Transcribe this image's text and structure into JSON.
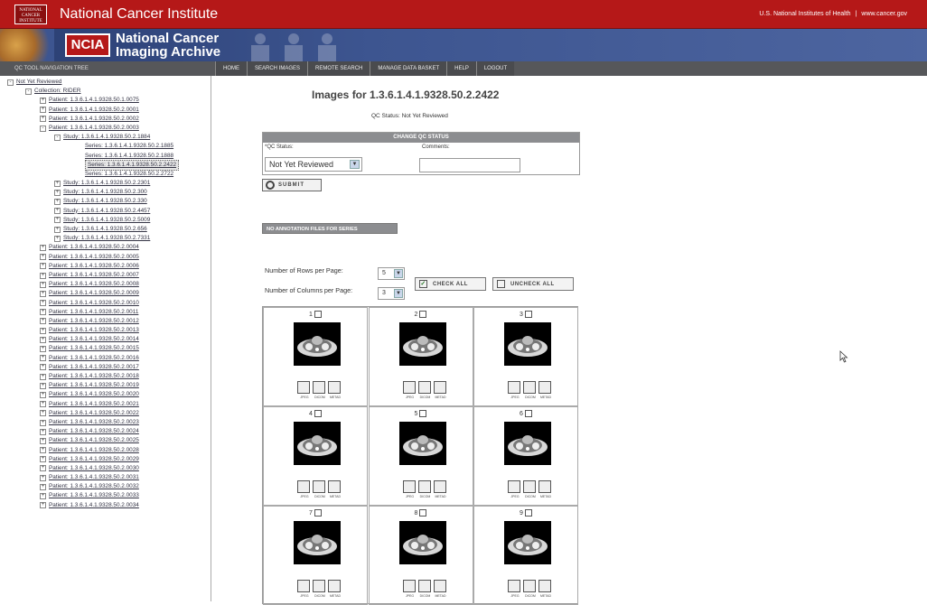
{
  "header": {
    "org": "National Cancer Institute",
    "logo_text": "NATIONAL CANCER INSTITUTE",
    "nih": "U.S. National Institutes of Health",
    "sep": "|",
    "nci_site": "www.cancer.gov"
  },
  "banner": {
    "badge": "NCIA",
    "name_line1": "National Cancer",
    "name_line2": "Imaging Archive"
  },
  "nav": {
    "tree_label": "QC TOOL NAVIGATION TREE",
    "items": [
      "HOME",
      "SEARCH IMAGES",
      "REMOTE SEARCH",
      "MANAGE DATA BASKET",
      "HELP",
      "LOGOUT"
    ]
  },
  "tree": {
    "root": "Not Yet Reviewed",
    "collection": "Collection: RIDER",
    "patients_top": [
      "Patient: 1.3.6.1.4.1.9328.50.1.0075",
      "Patient: 1.3.6.1.4.1.9328.50.2.0001",
      "Patient: 1.3.6.1.4.1.9328.50.2.0002",
      "Patient: 1.3.6.1.4.1.9328.50.2.0003"
    ],
    "study_open": "Study: 1.3.6.1.4.1.9328.50.2.1884",
    "series": [
      "Series: 1.3.6.1.4.1.9328.50.2.1885",
      "Series: 1.3.6.1.4.1.9328.50.2.1888",
      "Series: 1.3.6.1.4.1.9328.50.2.2422",
      "Series: 1.3.6.1.4.1.9328.50.2.2722"
    ],
    "studies": [
      "Study: 1.3.6.1.4.1.9328.50.2.2301",
      "Study: 1.3.6.1.4.1.9328.50.2.300",
      "Study: 1.3.6.1.4.1.9328.50.2.330",
      "Study: 1.3.6.1.4.1.9328.50.2.4457",
      "Study: 1.3.6.1.4.1.9328.50.2.5009",
      "Study: 1.3.6.1.4.1.9328.50.2.656",
      "Study: 1.3.6.1.4.1.9328.50.2.7331"
    ],
    "patients": [
      "Patient: 1.3.6.1.4.1.9328.50.2.0004",
      "Patient: 1.3.6.1.4.1.9328.50.2.0005",
      "Patient: 1.3.6.1.4.1.9328.50.2.0006",
      "Patient: 1.3.6.1.4.1.9328.50.2.0007",
      "Patient: 1.3.6.1.4.1.9328.50.2.0008",
      "Patient: 1.3.6.1.4.1.9328.50.2.0009",
      "Patient: 1.3.6.1.4.1.9328.50.2.0010",
      "Patient: 1.3.6.1.4.1.9328.50.2.0011",
      "Patient: 1.3.6.1.4.1.9328.50.2.0012",
      "Patient: 1.3.6.1.4.1.9328.50.2.0013",
      "Patient: 1.3.6.1.4.1.9328.50.2.0014",
      "Patient: 1.3.6.1.4.1.9328.50.2.0015",
      "Patient: 1.3.6.1.4.1.9328.50.2.0016",
      "Patient: 1.3.6.1.4.1.9328.50.2.0017",
      "Patient: 1.3.6.1.4.1.9328.50.2.0018",
      "Patient: 1.3.6.1.4.1.9328.50.2.0019",
      "Patient: 1.3.6.1.4.1.9328.50.2.0020",
      "Patient: 1.3.6.1.4.1.9328.50.2.0021",
      "Patient: 1.3.6.1.4.1.9328.50.2.0022",
      "Patient: 1.3.6.1.4.1.9328.50.2.0023",
      "Patient: 1.3.6.1.4.1.9328.50.2.0024",
      "Patient: 1.3.6.1.4.1.9328.50.2.0025",
      "Patient: 1.3.6.1.4.1.9328.50.2.0028",
      "Patient: 1.3.6.1.4.1.9328.50.2.0029",
      "Patient: 1.3.6.1.4.1.9328.50.2.0030",
      "Patient: 1.3.6.1.4.1.9328.50.2.0031",
      "Patient: 1.3.6.1.4.1.9328.50.2.0032",
      "Patient: 1.3.6.1.4.1.9328.50.2.0033",
      "Patient: 1.3.6.1.4.1.9328.50.2.0034"
    ]
  },
  "main": {
    "heading": "Images for 1.3.6.1.4.1.9328.50.2.2422",
    "qc_status_text": "QC Status: Not Yet Reviewed",
    "change_qc_header": "CHANGE QC STATUS",
    "qc_status_label": "*QC Status:",
    "comments_label": "Comments:",
    "qc_selected": "Not Yet Reviewed",
    "comments_value": "",
    "submit_label": "SUBMIT",
    "annotation_banner": "NO ANNOTATION FILES FOR SERIES",
    "rows_label": "Number of Rows per Page:",
    "rows_value": "5",
    "cols_label": "Number of Columns per Page:",
    "cols_value": "3",
    "check_all": "CHECK ALL",
    "uncheck_all": "UNCHECK ALL",
    "check_mark": "✓"
  },
  "icons": {
    "jpeg": "JPEG",
    "dicom": "DICOM",
    "metadata": "METAD",
    "chevron": "▼",
    "collapse": "-",
    "expand": "+"
  },
  "images": [
    "1",
    "2",
    "3",
    "4",
    "5",
    "6",
    "7",
    "8",
    "9"
  ],
  "colors": {
    "nci_red": "#b51818",
    "banner_blue": "#3d5590",
    "nav_gray": "#56575a"
  }
}
